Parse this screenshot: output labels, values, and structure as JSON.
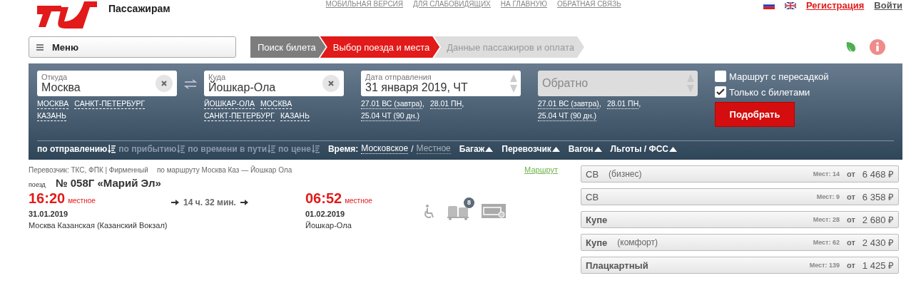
{
  "header": {
    "brand": "Пассажирам",
    "top_links": [
      "МОБИЛЬНАЯ ВЕРСИЯ",
      "ДЛЯ СЛАБОВИДЯЩИХ",
      "НА ГЛАВНУЮ",
      "ОБРАТНАЯ СВЯЗЬ"
    ],
    "register": "Регистрация",
    "login": "Войти"
  },
  "menu": {
    "label": "Меню"
  },
  "steps": [
    {
      "label": "Поиск билета",
      "done": true,
      "selected": false
    },
    {
      "label": "Выбор поезда и места",
      "done": false,
      "selected": true
    },
    {
      "label": "Данные пассажиров и оплата",
      "done": false,
      "selected": false
    }
  ],
  "search": {
    "from": {
      "label": "Откуда",
      "value": "Москва",
      "suggestions": [
        "МОСКВА",
        "САНКТ-ПЕТЕРБУРГ",
        "КАЗАНЬ"
      ]
    },
    "to": {
      "label": "Куда",
      "value": "Йошкар-Ола",
      "suggestions": [
        "ЙОШКАР-ОЛА",
        "МОСКВА",
        "САНКТ-ПЕТЕРБУРГ",
        "КАЗАНЬ"
      ]
    },
    "date": {
      "label": "Дата отправления",
      "value": "31 января 2019, ЧТ",
      "quick": [
        "27.01 ВС (завтра)",
        "28.01 ПН",
        "25.04 ЧТ (90 дн.)"
      ],
      "separators": [
        ",",
        ","
      ]
    },
    "return": {
      "placeholder": "Обратно",
      "quick": [
        "27.01 ВС (завтра)",
        "28.01 ПН",
        "25.04 ЧТ (90 дн.)"
      ],
      "separators": [
        ",",
        ","
      ]
    },
    "options": [
      {
        "label": "Маршрут с пересадкой",
        "checked": false
      },
      {
        "label": "Только с билетами",
        "checked": true
      }
    ],
    "submit": "Подобрать"
  },
  "sort": [
    {
      "label": "по отправлению",
      "selected": true
    },
    {
      "label": "по прибытию",
      "selected": false
    },
    {
      "label": "по времени в пути",
      "selected": false
    },
    {
      "label": "по цене",
      "selected": false
    }
  ],
  "time": {
    "label": "Время:",
    "separator": "/",
    "options": [
      {
        "label": "Московское",
        "selected": true
      },
      {
        "label": "Местное",
        "selected": false
      }
    ]
  },
  "filters": [
    "Багаж",
    "Перевозчик",
    "Вагон",
    "Льготы / ФСС"
  ],
  "train": {
    "carrier": "Перевозчик: ТКС, ФПК | Фирменный",
    "route": "по маршруту Москва Каз — Йошкар Ола",
    "route_link": "Маршрут",
    "prefix": "поезд",
    "number": "№ 058Г «Марий Эл»",
    "departure": {
      "time": "16:20",
      "zone": "местное",
      "date": "31.01.2019",
      "station": "Москва Казанская (Казанский Вокзал)"
    },
    "duration": "14 ч. 32 мин.",
    "arrival": {
      "time": "06:52",
      "zone": "местное",
      "date": "01.02.2019",
      "station": "Йошкар-Ола"
    },
    "baggage_count": "8"
  },
  "classes": [
    {
      "name": "СВ",
      "sub": "(бизнес)",
      "bold": false,
      "seats": "Мест: 14",
      "from": "от",
      "price": "6 468 ₽"
    },
    {
      "name": "СВ",
      "bold": false,
      "seats": "Мест: 9",
      "from": "от",
      "price": "6 358 ₽"
    },
    {
      "name": "Купе",
      "bold": true,
      "seats": "Мест: 28",
      "from": "от",
      "price": "2 680 ₽"
    },
    {
      "name": "Купе",
      "sub": "(комфорт)",
      "bold": true,
      "seats": "Мест: 62",
      "from": "от",
      "price": "2 430 ₽"
    },
    {
      "name": "Плацкартный",
      "bold": true,
      "seats": "Мест: 139",
      "from": "от",
      "price": "1 425 ₽"
    }
  ]
}
